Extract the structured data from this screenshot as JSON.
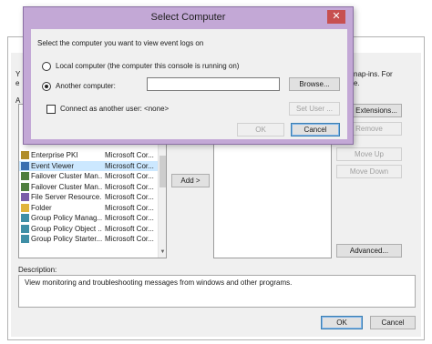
{
  "background_dialog": {
    "partial_left_text_1": "Y",
    "partial_left_text_2": "e",
    "partial_left_text_3": "A",
    "snapins_partial_text": "nap-ins. For",
    "snapins_partial_text_2": "e.",
    "edit_extensions_label": "Edit Extensions...",
    "remove_label": "Remove",
    "move_up_label": "Move Up",
    "move_down_label": "Move Down",
    "add_label": "Add >",
    "advanced_label": "Advanced...",
    "description_label": "Description:",
    "description_text": "View monitoring and troubleshooting messages from windows and other programs.",
    "ok_label": "OK",
    "cancel_label": "Cancel",
    "snapins": [
      {
        "name": "Enterprise PKI",
        "vendor": "Microsoft Cor...",
        "icon": "pki-icon"
      },
      {
        "name": "Event Viewer",
        "vendor": "Microsoft Cor...",
        "icon": "event-viewer-icon",
        "selected": true
      },
      {
        "name": "Failover Cluster Man...",
        "vendor": "Microsoft Cor...",
        "icon": "cluster-icon"
      },
      {
        "name": "Failover Cluster Man...",
        "vendor": "Microsoft Cor...",
        "icon": "cluster-icon"
      },
      {
        "name": "File Server Resource...",
        "vendor": "Microsoft Cor...",
        "icon": "file-server-icon"
      },
      {
        "name": "Folder",
        "vendor": "Microsoft Cor...",
        "icon": "folder-icon"
      },
      {
        "name": "Group Policy Manag...",
        "vendor": "Microsoft Cor...",
        "icon": "group-policy-icon"
      },
      {
        "name": "Group Policy Object ...",
        "vendor": "Microsoft Cor...",
        "icon": "group-policy-icon"
      },
      {
        "name": "Group Policy Starter...",
        "vendor": "Microsoft Cor...",
        "icon": "group-policy-icon"
      }
    ]
  },
  "select_computer": {
    "title": "Select Computer",
    "close_glyph": "✕",
    "prompt": "Select the computer you want to view event logs on",
    "local_label": "Local computer (the computer this console is running on)",
    "another_label": "Another computer:",
    "another_value": "",
    "browse_label": "Browse...",
    "connect_as_label": "Connect as another user: <none>",
    "set_user_label": "Set User ...",
    "ok_label": "OK",
    "cancel_label": "Cancel",
    "local_selected": false,
    "another_selected": true,
    "connect_as_checked": false
  },
  "colors": {
    "title_bar": "#c3a8d6",
    "close_button": "#c75050",
    "selection": "#cce8ff"
  }
}
